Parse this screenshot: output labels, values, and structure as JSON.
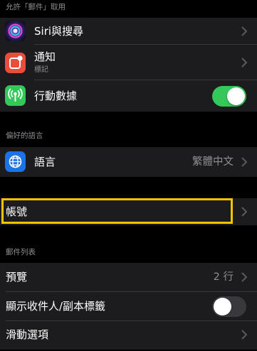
{
  "section_allow": {
    "header": "允許「郵件」取用",
    "items": [
      {
        "label": "Siri與搜尋",
        "icon": "siri-icon"
      },
      {
        "label": "通知",
        "sublabel": "標記",
        "icon": "notifications-icon"
      },
      {
        "label": "行動數據",
        "icon": "cellular-data-icon",
        "toggle_on": true
      }
    ]
  },
  "section_language": {
    "header": "偏好的語言",
    "item": {
      "label": "語言",
      "value": "繁體中文",
      "icon": "globe-icon"
    }
  },
  "section_accounts": {
    "item": {
      "label": "帳號"
    }
  },
  "section_message_list": {
    "header": "郵件列表",
    "items": [
      {
        "label": "預覽",
        "value": "2 行"
      },
      {
        "label": "顯示收件人/副本標籤",
        "toggle_on": false
      },
      {
        "label": "滑動選項"
      }
    ]
  },
  "colors": {
    "background": "#000000",
    "cell": "#1c1c1e",
    "toggle_on": "#34c759",
    "toggle_off": "#39393d",
    "highlight": "#f5c400",
    "notifications_icon": "#eb4d3d",
    "cellular_icon": "#34c759",
    "globe_icon": "#1a73e8"
  }
}
